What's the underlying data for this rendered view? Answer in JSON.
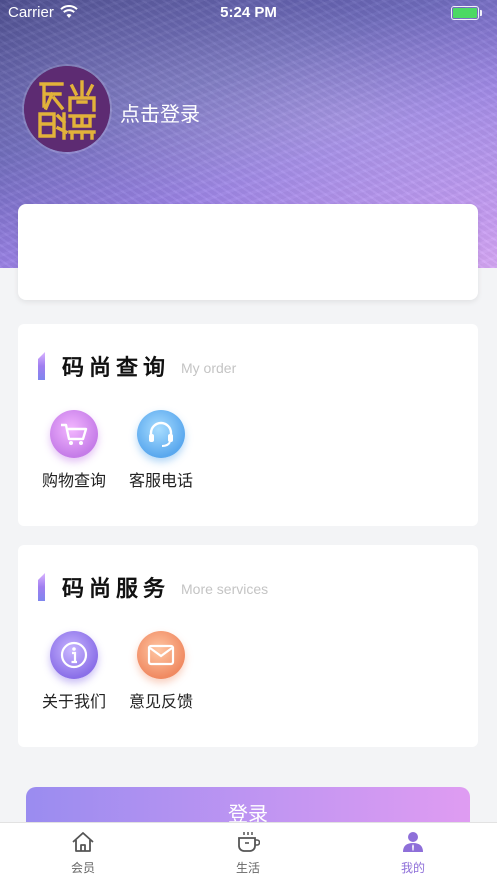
{
  "status_bar": {
    "carrier": "Carrier",
    "time": "5:24 PM"
  },
  "header": {
    "login_prompt": "点击登录",
    "avatar_logo_text": "码尚联盟"
  },
  "sections": [
    {
      "title": "码尚查询",
      "subtitle": "My order",
      "items": [
        {
          "label": "购物查询",
          "icon": "shopping-cart-icon"
        },
        {
          "label": "客服电话",
          "icon": "headset-icon"
        }
      ]
    },
    {
      "title": "码尚服务",
      "subtitle": "More services",
      "items": [
        {
          "label": "关于我们",
          "icon": "info-icon"
        },
        {
          "label": "意见反馈",
          "icon": "mail-icon"
        }
      ]
    }
  ],
  "login_button": "登录",
  "tabbar": [
    {
      "label": "会员",
      "icon": "home-icon",
      "active": false
    },
    {
      "label": "生活",
      "icon": "coffee-cup-icon",
      "active": false
    },
    {
      "label": "我的",
      "icon": "user-icon",
      "active": true
    }
  ],
  "colors": {
    "accent": "#8e6fd9",
    "button_gradient_start": "#9a8cf0",
    "button_gradient_end": "#df9cf2"
  }
}
